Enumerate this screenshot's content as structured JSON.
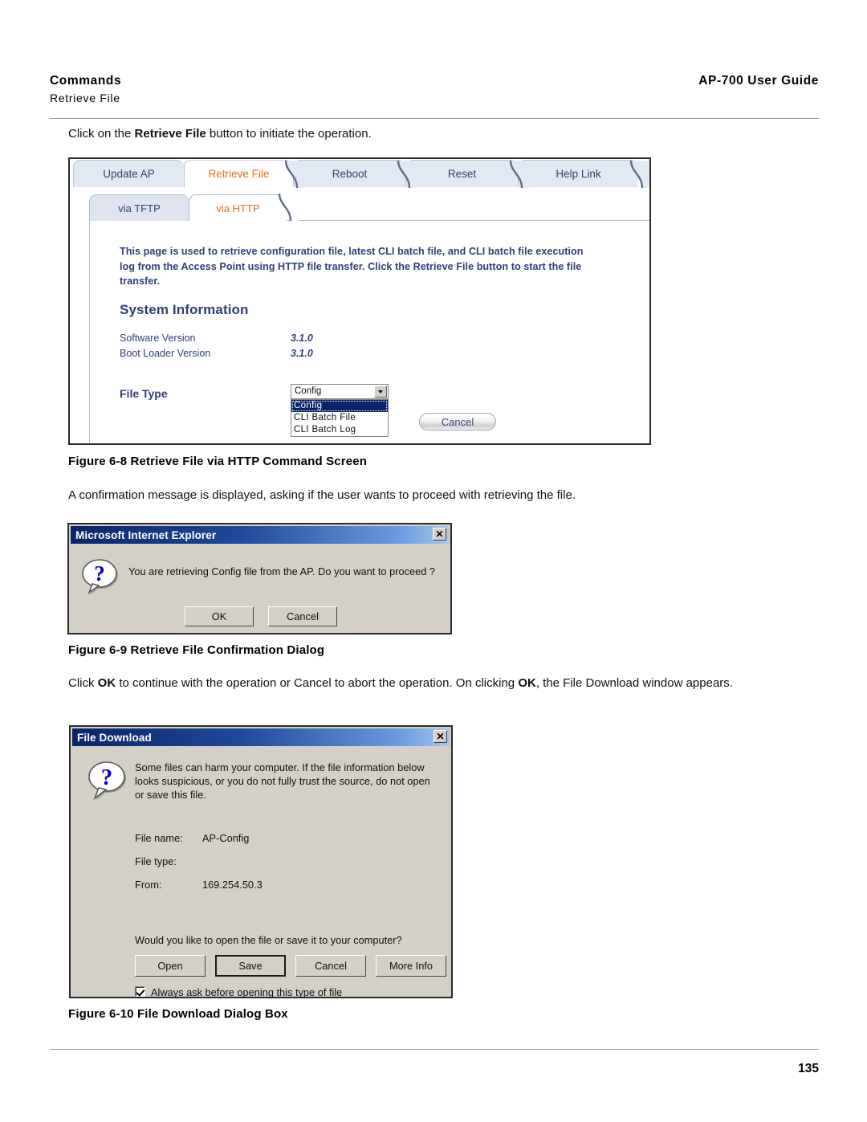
{
  "header": {
    "left_title": "Commands",
    "left_subtitle": "Retrieve File",
    "right_title": "AP-700 User Guide"
  },
  "intro_paragraph": {
    "before": "Click on the ",
    "bold": "Retrieve File",
    "after": " button to initiate the operation."
  },
  "figure_68": {
    "caption": "Figure 6-8 Retrieve File via HTTP Command Screen",
    "tabs": [
      {
        "label": "Update AP",
        "active": false
      },
      {
        "label": "Retrieve File",
        "active": true
      },
      {
        "label": "Reboot",
        "active": false
      },
      {
        "label": "Reset",
        "active": false
      },
      {
        "label": "Help Link",
        "active": false
      }
    ],
    "subtabs": [
      {
        "label": "via TFTP",
        "active": false
      },
      {
        "label": "via HTTP",
        "active": true
      }
    ],
    "description": "This page is used to retrieve configuration file, latest CLI batch file, and CLI batch file execution log from the Access Point using HTTP file transfer. Click the Retrieve File button to start the file transfer.",
    "section_title": "System Information",
    "rows": [
      {
        "label": "Software Version",
        "value": "3.1.0"
      },
      {
        "label": "Boot Loader Version",
        "value": "3.1.0"
      }
    ],
    "file_type": {
      "label": "File Type",
      "selected": "Config",
      "options": [
        "Config",
        "CLI Batch File",
        "CLI Batch Log"
      ]
    },
    "cancel_button": "Cancel",
    "colors": {
      "active_tab_text": "#f26a20",
      "inactive_tab_text": "#33406b",
      "tab_background": "#e3e9f3",
      "panel_text": "#2e3f78",
      "highlight": "#0a246a"
    }
  },
  "paragraph_confirmation": "A confirmation message is displayed, asking if the user wants to proceed with retrieving the file.",
  "figure_69": {
    "caption": "Figure 6-9 Retrieve File Confirmation Dialog",
    "dialog": {
      "title": "Microsoft Internet Explorer",
      "close_label": "✕",
      "message": "You are retrieving Config file from the AP. Do you want to proceed ?",
      "buttons": [
        {
          "label": "OK",
          "default": true
        },
        {
          "label": "Cancel",
          "default": false
        }
      ]
    }
  },
  "paragraph_ok": {
    "p1": "Click ",
    "b1": "OK",
    "p2": " to continue with the operation or Cancel to abort the operation. On clicking ",
    "b2": "OK",
    "p3": ", the File Download window appears."
  },
  "figure_610": {
    "caption": "Figure 6-10 File Download Dialog Box",
    "dialog": {
      "title": "File Download",
      "close_label": "✕",
      "warning": "Some files can harm your computer. If the file information below looks suspicious, or you do not fully trust the source, do not open or save this file.",
      "fields": [
        {
          "label": "File name:",
          "value": "AP-Config"
        },
        {
          "label": "File type:",
          "value": ""
        },
        {
          "label": "From:",
          "value": "169.254.50.3"
        }
      ],
      "question": "Would you like to open the file or save it to your computer?",
      "buttons": [
        {
          "label": "Open",
          "default": false
        },
        {
          "label": "Save",
          "default": true
        },
        {
          "label": "Cancel",
          "default": false
        },
        {
          "label": "More Info",
          "default": false
        }
      ],
      "checkbox": {
        "label": "Always ask before opening this type of file",
        "checked": true
      }
    }
  },
  "footer": {
    "page_number": "135"
  }
}
